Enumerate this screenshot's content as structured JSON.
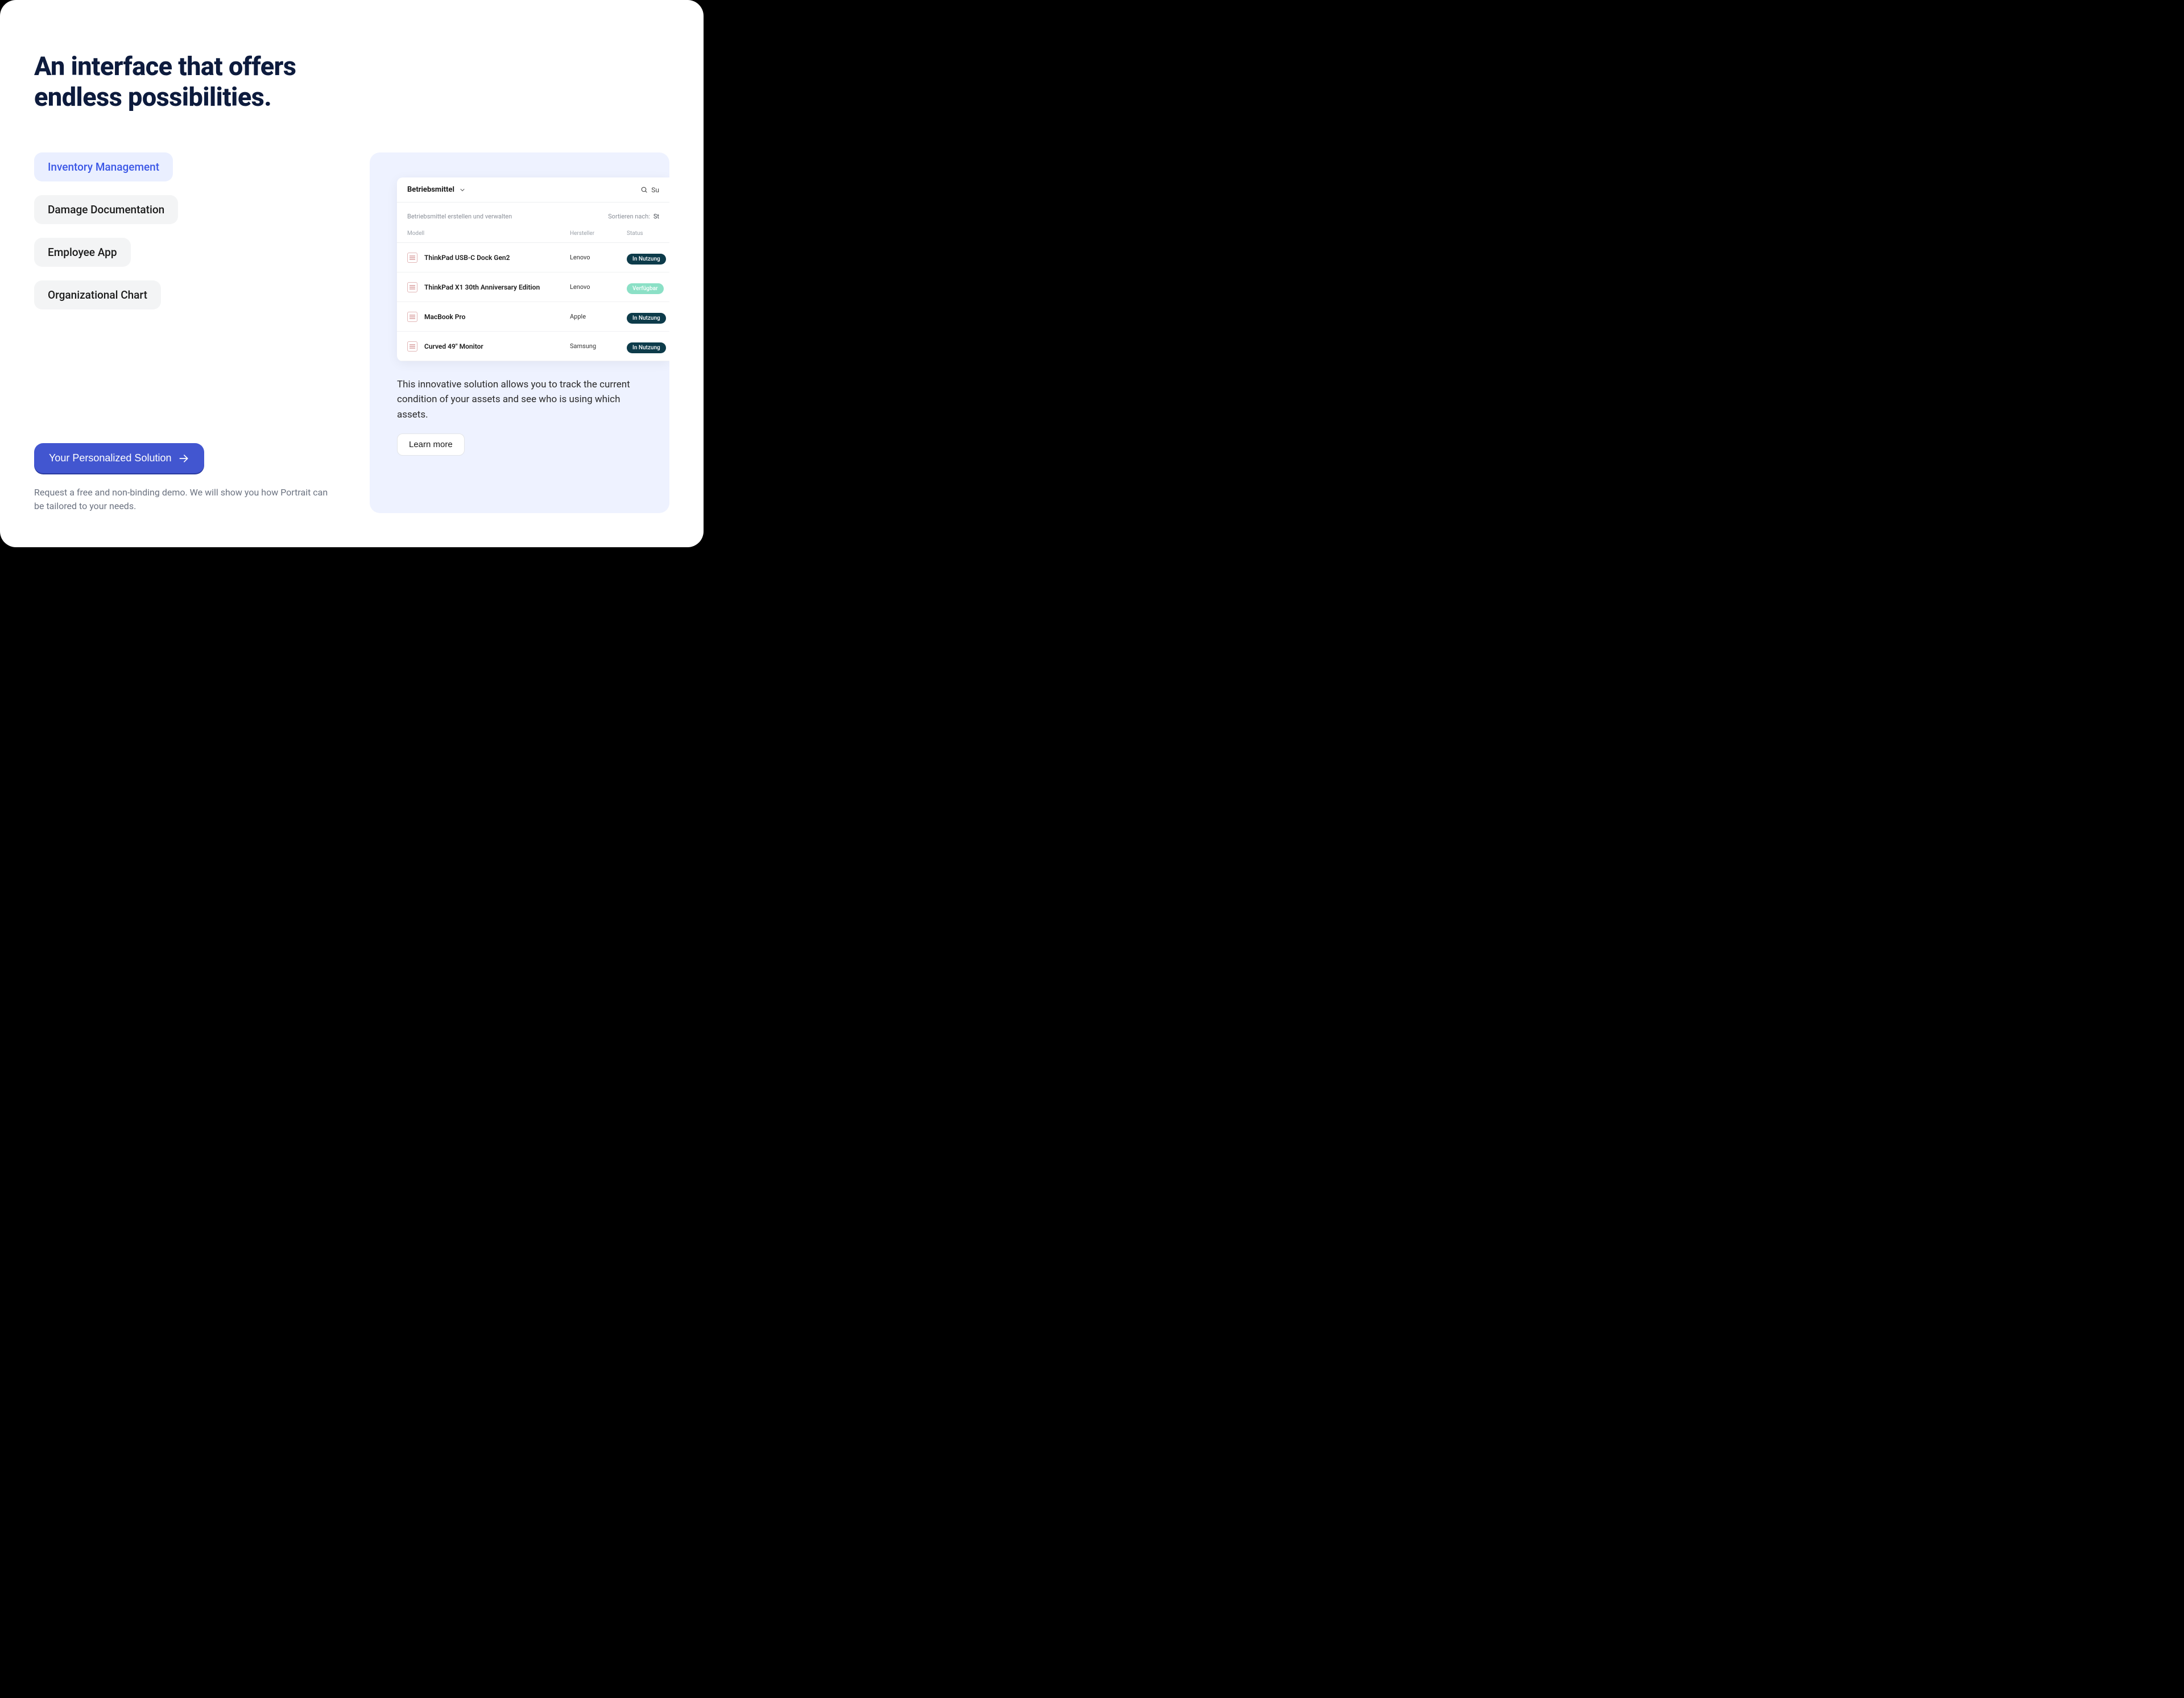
{
  "headline": "An interface that offers endless possibilities.",
  "tabs": [
    {
      "label": "Inventory Management",
      "active": true
    },
    {
      "label": "Damage Documentation",
      "active": false
    },
    {
      "label": "Employee App",
      "active": false
    },
    {
      "label": "Organizational Chart",
      "active": false
    }
  ],
  "cta": {
    "button": "Your Personalized Solution",
    "subtext": "Request a free and non-binding demo. We will show you how Portrait can be tailored to your needs."
  },
  "app": {
    "title": "Betriebsmittel",
    "search_text": "Su",
    "subtitle": "Betriebsmittel erstellen und verwalten",
    "sort_label": "Sortieren nach:",
    "sort_value": "St",
    "columns": {
      "model": "Modell",
      "manufacturer": "Hersteller",
      "status": "Status"
    },
    "rows": [
      {
        "model": "ThinkPad USB-C Dock Gen2",
        "manufacturer": "Lenovo",
        "status": "In Nutzung",
        "status_kind": "dark"
      },
      {
        "model": "ThinkPad X1 30th Anniversary Edition",
        "manufacturer": "Lenovo",
        "status": "Verfügbar",
        "status_kind": "green"
      },
      {
        "model": "MacBook Pro",
        "manufacturer": "Apple",
        "status": "In Nutzung",
        "status_kind": "dark"
      },
      {
        "model": "Curved 49\" Monitor",
        "manufacturer": "Samsung",
        "status": "In Nutzung",
        "status_kind": "dark"
      }
    ]
  },
  "panel": {
    "description": "This innovative solution allows you to track the current condition of your assets and see who is using which assets.",
    "learn_more": "Learn more"
  }
}
